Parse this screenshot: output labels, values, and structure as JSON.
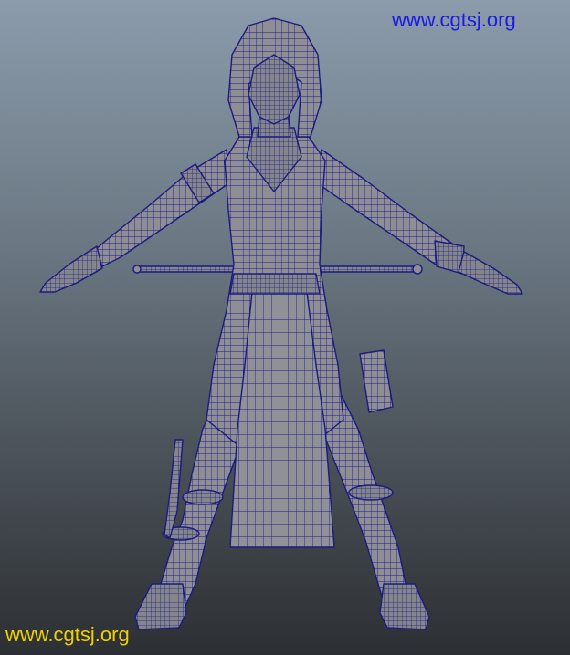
{
  "viewport": {
    "background_top": "#8b9bab",
    "background_bottom": "#2c2f33",
    "mesh_fill": "#8e8e94",
    "wire_color": "#1f1f8a"
  },
  "watermarks": {
    "top": "www.cgtsj.org",
    "bottom": "www.cgtsj.org",
    "top_color": "#1a1ae6",
    "bottom_color": "#f0d000"
  },
  "model": {
    "name_icon": "character-wireframe-mesh"
  }
}
